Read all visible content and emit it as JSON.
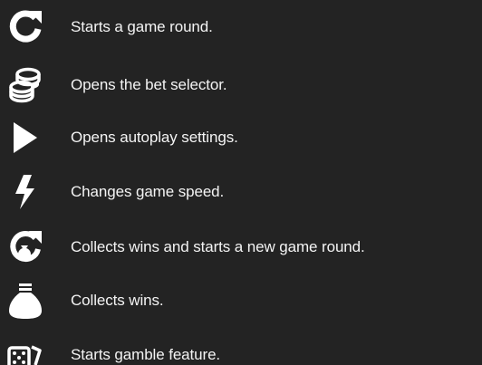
{
  "colors": {
    "background": "#232323",
    "icon": "#ffffff",
    "text": "#f4f4f4"
  },
  "legend": {
    "items": [
      {
        "icon": "refresh-icon",
        "label": "Starts a game round."
      },
      {
        "icon": "coins-icon",
        "label": "Opens the bet selector."
      },
      {
        "icon": "play-icon",
        "label": "Opens autoplay settings."
      },
      {
        "icon": "lightning-icon",
        "label": "Changes game speed."
      },
      {
        "icon": "collect-restart-icon",
        "label": "Collects wins and starts a new game round."
      },
      {
        "icon": "money-bag-icon",
        "label": "Collects wins."
      },
      {
        "icon": "dice-icon",
        "label": "Starts gamble feature."
      }
    ]
  }
}
